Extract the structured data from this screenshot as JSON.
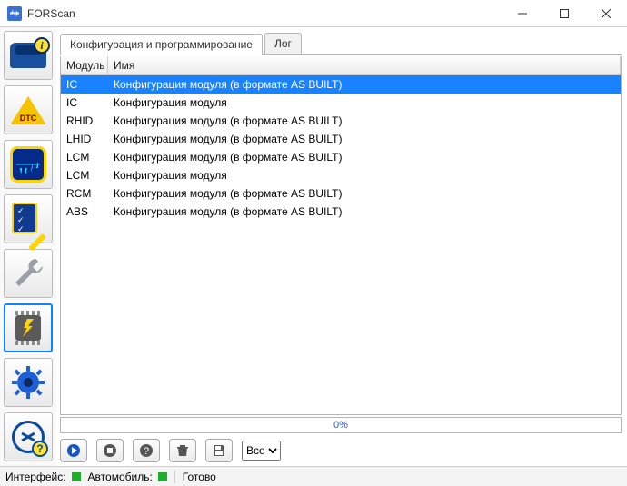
{
  "window": {
    "title": "FORScan"
  },
  "sidebar": {
    "items": [
      {
        "name": "vehicle-info-button",
        "icon": "vehicle-icon",
        "badge": "i"
      },
      {
        "name": "dtc-button",
        "icon": "dtc-icon",
        "label": "DTC"
      },
      {
        "name": "live-data-button",
        "icon": "oscilloscope-icon"
      },
      {
        "name": "tests-button",
        "icon": "checklist-icon"
      },
      {
        "name": "service-button",
        "icon": "wrench-icon"
      },
      {
        "name": "programming-button",
        "icon": "chip-icon",
        "active": true
      },
      {
        "name": "settings-button",
        "icon": "gear-icon"
      },
      {
        "name": "help-button",
        "icon": "steering-help-icon",
        "badge": "?"
      }
    ]
  },
  "tabs": {
    "items": [
      {
        "label": "Конфигурация и программирование",
        "active": true
      },
      {
        "label": "Лог",
        "active": false
      }
    ]
  },
  "table": {
    "headers": {
      "module": "Модуль",
      "name": "Имя"
    },
    "rows": [
      {
        "module": "IC",
        "name": "Конфигурация модуля (в формате AS BUILT)",
        "selected": true
      },
      {
        "module": "IC",
        "name": "Конфигурация модуля"
      },
      {
        "module": "RHID",
        "name": "Конфигурация модуля (в формате AS BUILT)"
      },
      {
        "module": "LHID",
        "name": "Конфигурация модуля (в формате AS BUILT)"
      },
      {
        "module": "LCM",
        "name": "Конфигурация модуля (в формате AS BUILT)"
      },
      {
        "module": "LCM",
        "name": "Конфигурация модуля"
      },
      {
        "module": "RCM",
        "name": "Конфигурация модуля (в формате AS BUILT)"
      },
      {
        "module": "ABS",
        "name": "Конфигурация модуля (в формате AS BUILT)"
      }
    ]
  },
  "progress": {
    "text": "0%"
  },
  "toolbar": {
    "buttons": [
      {
        "name": "run-button",
        "icon": "play-icon"
      },
      {
        "name": "stop-button",
        "icon": "stop-icon"
      },
      {
        "name": "info-button",
        "icon": "question-icon"
      },
      {
        "name": "delete-button",
        "icon": "trash-icon"
      },
      {
        "name": "save-button",
        "icon": "save-icon"
      }
    ],
    "filter": {
      "selected": "Все",
      "options": [
        "Все"
      ]
    }
  },
  "statusbar": {
    "interface_label": "Интерфейс:",
    "vehicle_label": "Автомобиль:",
    "status_text": "Готово",
    "colors": {
      "ok": "#1fae2a"
    }
  }
}
